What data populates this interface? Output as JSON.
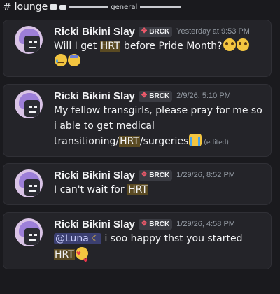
{
  "header": {
    "hash": "#",
    "channel_name": "lounge",
    "section_label": "general"
  },
  "messages": [
    {
      "username": "Ricki Bikini Slay",
      "tag": "BRCK",
      "timestamp": "Yesterday at 9:53 PM",
      "text_1": "Will I get ",
      "highlight_1": "HRT",
      "text_2": " before Pride Month?",
      "emojis": [
        "pleading-face",
        "pleading-face",
        "sad-but-relieved-face",
        "downcast-face-with-sweat"
      ]
    },
    {
      "username": "Ricki Bikini Slay",
      "tag": "BRCK",
      "timestamp": "2/9/26, 5:10 PM",
      "text_1": "My fellow transgirls, please pray for me so i able to get medical transitioning/",
      "highlight_1": "HRT",
      "text_2": "/surgeries",
      "edited": "(edited)",
      "emojis": [
        "loudly-crying-face"
      ]
    },
    {
      "username": "Ricki Bikini Slay",
      "tag": "BRCK",
      "timestamp": "1/29/26, 8:52 PM",
      "text_1": "I can't wait for ",
      "highlight_1": "HRT"
    },
    {
      "username": "Ricki Bikini Slay",
      "tag": "BRCK",
      "timestamp": "1/29/26, 4:58 PM",
      "mention": "@Luna",
      "text_1": " i soo happy thst you started",
      "highlight_1": "HRT",
      "emojis": [
        "crescent-moon",
        "smiling-face-with-hearts"
      ]
    }
  ],
  "colors": {
    "background": "#1a1a1e",
    "card": "#242429",
    "highlight": "#5a4a22",
    "mention": "#3b3f71",
    "username": "#f2f3f5",
    "timestamp": "#949ba4"
  }
}
